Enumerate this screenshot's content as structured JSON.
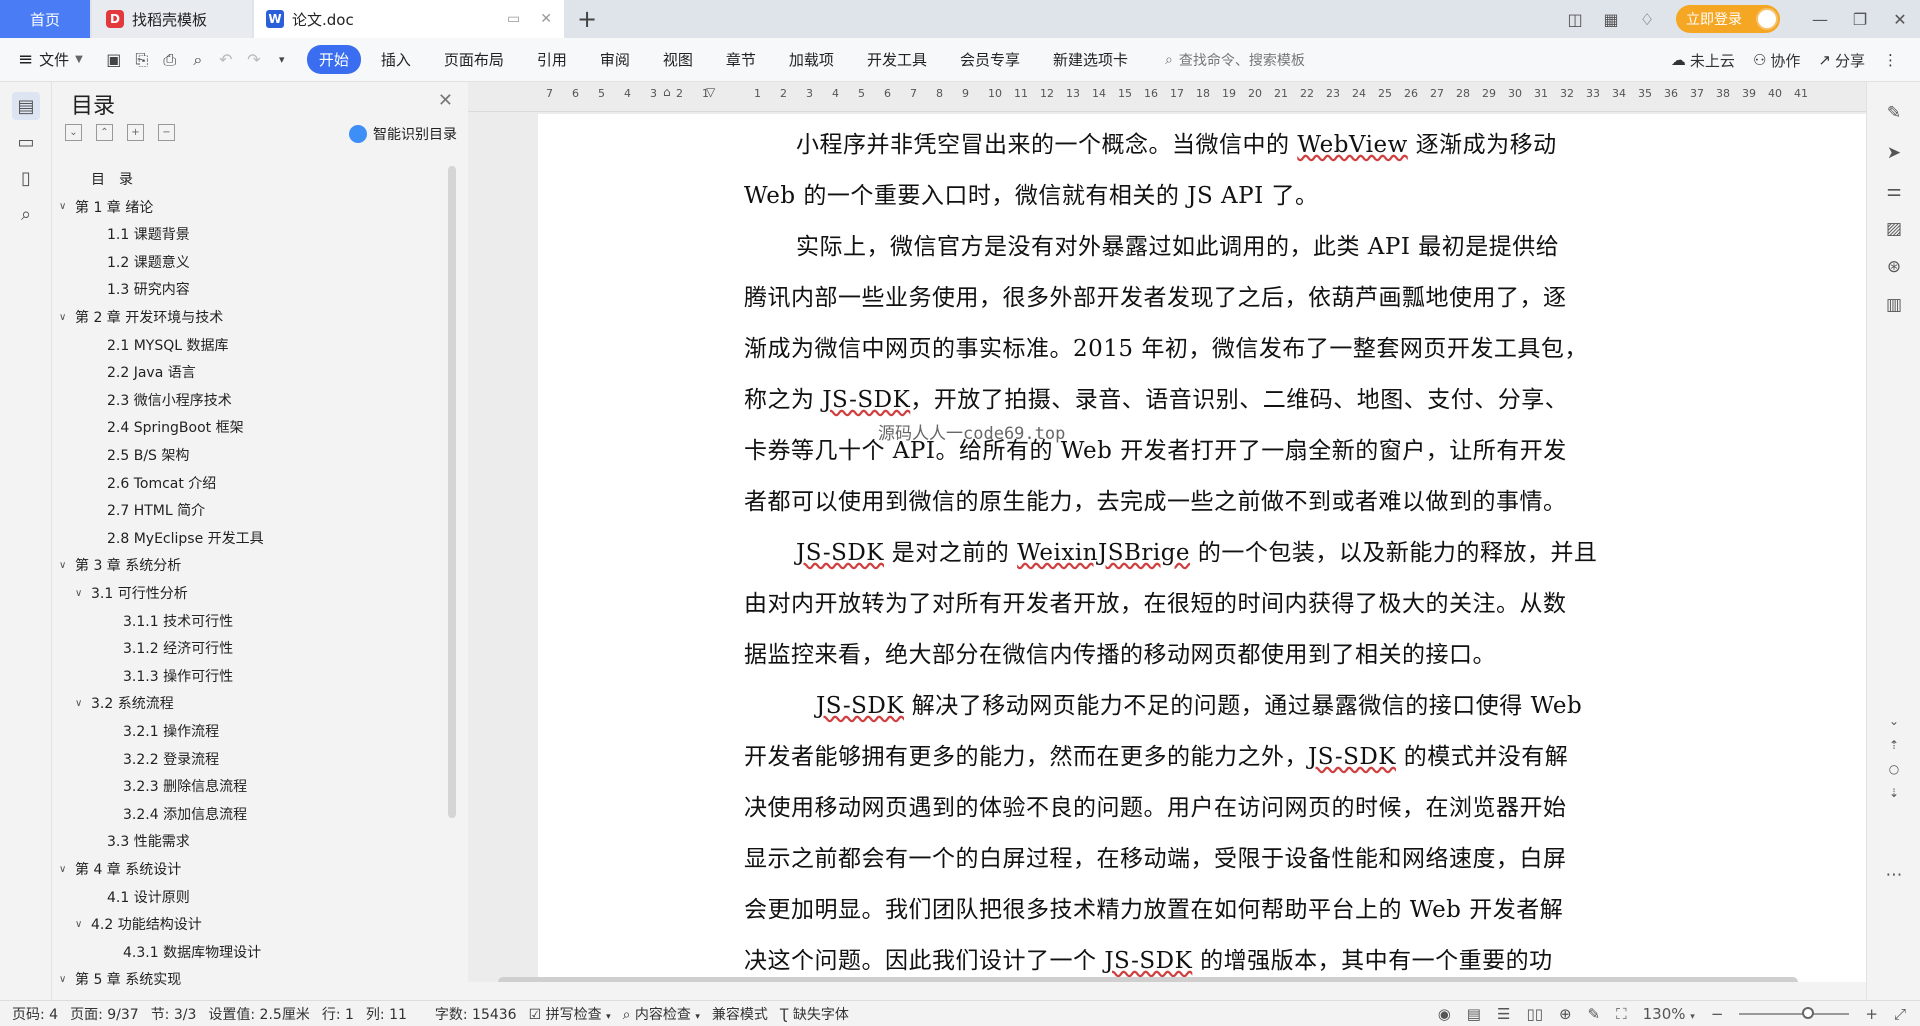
{
  "titlebar": {
    "tabs": [
      {
        "label": "首页"
      },
      {
        "label": "找稻壳模板"
      },
      {
        "label": "论文.doc"
      }
    ],
    "login_label": "立即登录"
  },
  "ribbon": {
    "file_label": "文件",
    "tabs": [
      "开始",
      "插入",
      "页面布局",
      "引用",
      "审阅",
      "视图",
      "章节",
      "加载项",
      "开发工具",
      "会员专享",
      "新建选项卡"
    ],
    "search_placeholder": "查找命令、搜索模板",
    "cloud_label": "未上云",
    "collab_label": "协作",
    "share_label": "分享"
  },
  "toc": {
    "title": "目录",
    "ai_label": "智能识别目录",
    "items": [
      {
        "label": "目　录",
        "level": 1,
        "arrow": false
      },
      {
        "label": "第 1 章  绪论",
        "level": 1,
        "arrow": true
      },
      {
        "label": "1.1  课题背景",
        "level": 2,
        "arrow": false
      },
      {
        "label": "1.2  课题意义",
        "level": 2,
        "arrow": false
      },
      {
        "label": "1.3  研究内容",
        "level": 2,
        "arrow": false
      },
      {
        "label": "第 2 章  开发环境与技术",
        "level": 1,
        "arrow": true
      },
      {
        "label": "2.1 MYSQL 数据库",
        "level": 2,
        "arrow": false
      },
      {
        "label": "2.2 Java 语言",
        "level": 2,
        "arrow": false
      },
      {
        "label": "2.3  微信小程序技术",
        "level": 2,
        "arrow": false
      },
      {
        "label": "2.4 SpringBoot 框架",
        "level": 2,
        "arrow": false
      },
      {
        "label": "2.5 B/S 架构",
        "level": 2,
        "arrow": false
      },
      {
        "label": "2.6 Tomcat  介绍",
        "level": 2,
        "arrow": false
      },
      {
        "label": "2.7 HTML 简介",
        "level": 2,
        "arrow": false
      },
      {
        "label": "2.8 MyEclipse 开发工具",
        "level": 2,
        "arrow": false
      },
      {
        "label": "第 3 章  系统分析",
        "level": 1,
        "arrow": true
      },
      {
        "label": "3.1  可行性分析",
        "level": 2,
        "arrow": true
      },
      {
        "label": "3.1.1  技术可行性",
        "level": 3,
        "arrow": false
      },
      {
        "label": "3.1.2  经济可行性",
        "level": 3,
        "arrow": false
      },
      {
        "label": "3.1.3  操作可行性",
        "level": 3,
        "arrow": false
      },
      {
        "label": "3.2  系统流程",
        "level": 2,
        "arrow": true
      },
      {
        "label": "3.2.1  操作流程",
        "level": 3,
        "arrow": false
      },
      {
        "label": "3.2.2  登录流程",
        "level": 3,
        "arrow": false
      },
      {
        "label": "3.2.3  删除信息流程",
        "level": 3,
        "arrow": false
      },
      {
        "label": "3.2.4  添加信息流程",
        "level": 3,
        "arrow": false
      },
      {
        "label": "3.3  性能需求",
        "level": 2,
        "arrow": false
      },
      {
        "label": "第 4 章  系统设计",
        "level": 1,
        "arrow": true
      },
      {
        "label": "4.1  设计原则",
        "level": 2,
        "arrow": false
      },
      {
        "label": "4.2  功能结构设计",
        "level": 2,
        "arrow": true
      },
      {
        "label": "4.3.1  数据库物理设计",
        "level": 3,
        "arrow": false
      },
      {
        "label": "第 5 章  系统实现",
        "level": 1,
        "arrow": true
      }
    ]
  },
  "ruler": {
    "ticks": [
      "7",
      "6",
      "5",
      "4",
      "3",
      "2",
      "1",
      "",
      "1",
      "2",
      "3",
      "4",
      "5",
      "6",
      "7",
      "8",
      "9",
      "10",
      "11",
      "12",
      "13",
      "14",
      "15",
      "16",
      "17",
      "18",
      "19",
      "20",
      "21",
      "22",
      "23",
      "24",
      "25",
      "26",
      "27",
      "28",
      "29",
      "30",
      "31",
      "32",
      "33",
      "34",
      "35",
      "36",
      "37",
      "38",
      "39",
      "40",
      "41"
    ]
  },
  "document": {
    "paragraphs": [
      {
        "indent": true,
        "lines": [
          [
            {
              "t": "小程序并非凭空冒出来的一个概念。当微信中的 "
            },
            {
              "t": "WebView",
              "u": true
            },
            {
              "t": " 逐渐成为移动"
            }
          ],
          [
            {
              "t": "Web 的一个重要入口时，微信就有相关的 JS API 了。"
            }
          ]
        ]
      },
      {
        "indent": true,
        "lines": [
          [
            {
              "t": "实际上，微信官方是没有对外暴露过如此调用的，此类 API 最初是提供给"
            }
          ],
          [
            {
              "t": "腾讯内部一些业务使用，很多外部开发者发现了之后，依葫芦画瓢地使用了，逐"
            }
          ],
          [
            {
              "t": "渐成为微信中网页的事实标准。2015 年初，微信发布了一整套网页开发工具包，"
            }
          ],
          [
            {
              "t": "称之为 "
            },
            {
              "t": "JS-SDK",
              "u": true
            },
            {
              "t": "，开放了拍摄、录音、语音识别、二维码、地图、支付、分享、"
            }
          ],
          [
            {
              "t": "卡券等几十个 API。给所有的 Web 开发者打开了一扇全新的窗户，让所有开发"
            }
          ],
          [
            {
              "t": "者都可以使用到微信的原生能力，去完成一些之前做不到或者难以做到的事情。"
            }
          ]
        ]
      },
      {
        "indent": true,
        "lines": [
          [
            {
              "t": "JS-SDK",
              "u": true
            },
            {
              "t": " 是对之前的 "
            },
            {
              "t": "WeixinJSBrige",
              "u": true
            },
            {
              "t": " 的一个包装，以及新能力的释放，并且"
            }
          ],
          [
            {
              "t": "由对内开放转为了对所有开发者开放，在很短的时间内获得了极大的关注。从数"
            }
          ],
          [
            {
              "t": "据监控来看，绝大部分在微信内传播的移动网页都使用到了相关的接口。"
            }
          ]
        ]
      },
      {
        "indent": true,
        "extra_indent": true,
        "lines": [
          [
            {
              "t": "JS-SDK",
              "u": true
            },
            {
              "t": " 解决了移动网页能力不足的问题，通过暴露微信的接口使得 Web"
            }
          ],
          [
            {
              "t": "开发者能够拥有更多的能力，然而在更多的能力之外，"
            },
            {
              "t": "JS-SDK",
              "u": true
            },
            {
              "t": " 的模式并没有解"
            }
          ],
          [
            {
              "t": "决使用移动网页遇到的体验不良的问题。用户在访问网页的时候，在浏览器开始"
            }
          ],
          [
            {
              "t": "显示之前都会有一个的白屏过程，在移动端，受限于设备性能和网络速度，白屏"
            }
          ],
          [
            {
              "t": "会更加明显。我们团队把很多技术精力放置在如何帮助平台上的 Web 开发者解"
            }
          ],
          [
            {
              "t": "决这个问题。因此我们设计了一个 "
            },
            {
              "t": "JS-SDK",
              "u": true
            },
            {
              "t": " 的增强版本，其中有一个重要的功"
            }
          ]
        ]
      }
    ],
    "watermark": "源码人人一code69.top"
  },
  "status": {
    "page_num": "页码: 4",
    "page_of": "页面: 9/37",
    "section": "节: 3/3",
    "setting": "设置值: 2.5厘米",
    "row": "行: 1",
    "col": "列: 11",
    "word_count": "字数: 15436",
    "spell_check": "拼写检查",
    "content_check": "内容检查",
    "compat_mode": "兼容模式",
    "missing_font": "缺失字体",
    "zoom": "130%",
    "zoom_level": 0.62
  }
}
